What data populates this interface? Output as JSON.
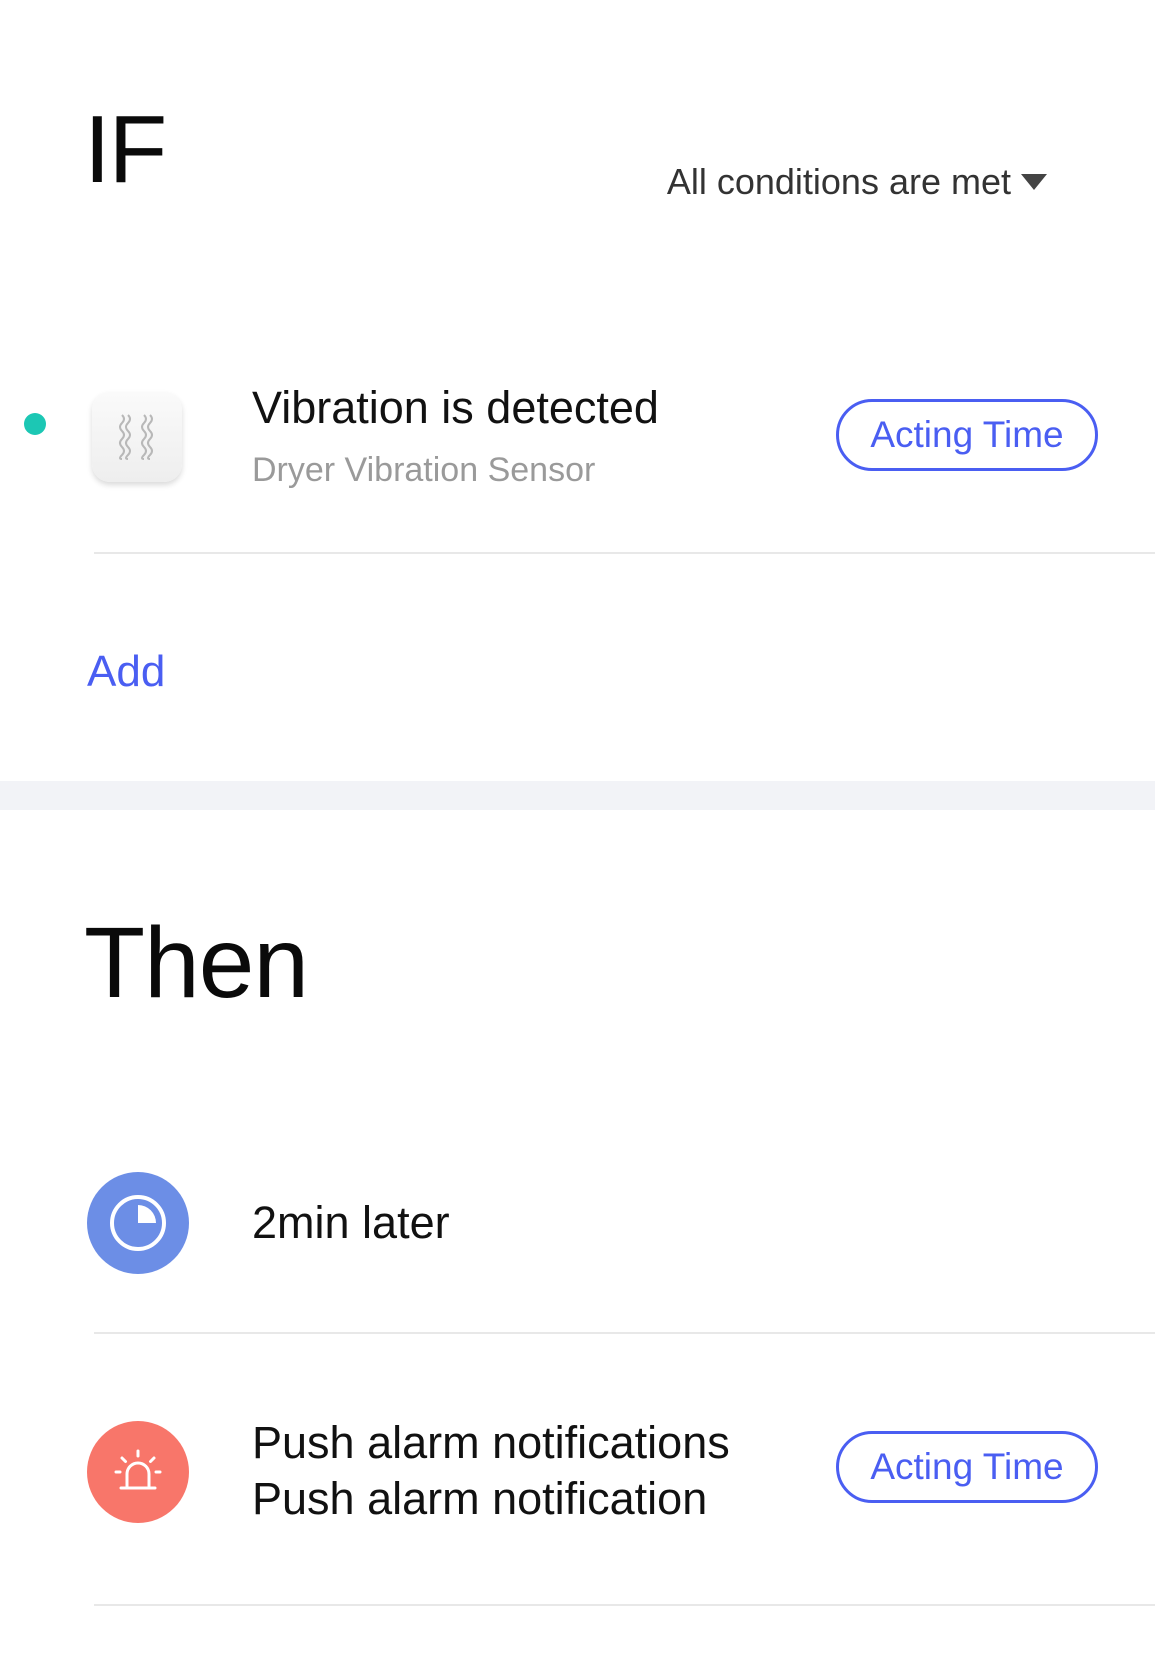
{
  "if_section": {
    "title": "IF",
    "condition_mode": "All conditions are met",
    "conditions": [
      {
        "title": "Vibration is detected",
        "device": "Dryer Vibration Sensor",
        "status_color": "#1cc7b4",
        "icon": "vibration-sensor-icon",
        "button_label": "Acting Time"
      }
    ],
    "add_label": "Add"
  },
  "then_section": {
    "title": "Then",
    "actions": [
      {
        "text": "2min later",
        "icon": "timer-icon",
        "icon_color": "#6c8ee6"
      },
      {
        "line1": "Push alarm notifications",
        "line2": "Push alarm notification",
        "icon": "alarm-light-icon",
        "icon_color": "#f8766a",
        "button_label": "Acting Time"
      }
    ]
  },
  "accent_color": "#4a5ef2"
}
